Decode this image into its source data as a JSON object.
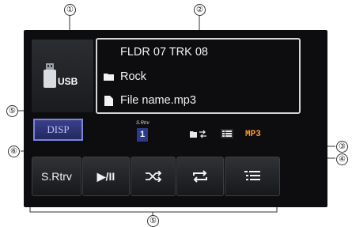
{
  "source": {
    "label": "USB"
  },
  "track_info": {
    "folder_track": "FLDR 07 TRK 08",
    "genre": "Rock",
    "file_name": "File name.mp3"
  },
  "disp_button": {
    "label": "DISP"
  },
  "s_rtrv_indicator": {
    "caption": "S.Rtrv",
    "value": "1"
  },
  "format_badge": "MP3",
  "controls": {
    "s_rtrv": "S.Rtrv",
    "play_pause": "▶/II"
  },
  "callouts": {
    "c1": "①",
    "c2": "②",
    "c3": "③",
    "c4": "④",
    "c5a": "⑤",
    "c5b": "⑤",
    "c6": "⑥"
  }
}
